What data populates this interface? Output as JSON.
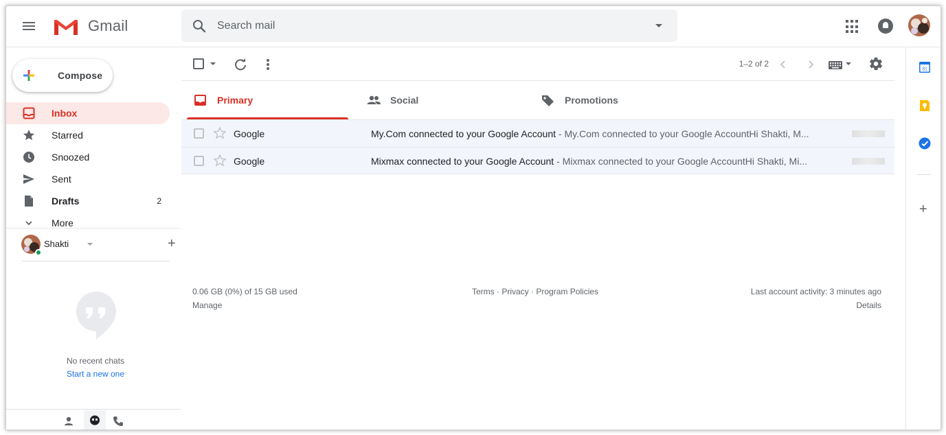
{
  "header": {
    "app_name": "Gmail",
    "search_placeholder": "Search mail"
  },
  "sidebar": {
    "compose_label": "Compose",
    "items": [
      {
        "label": "Inbox",
        "count": "",
        "icon": "inbox-icon",
        "active": true
      },
      {
        "label": "Starred",
        "count": "",
        "icon": "star-icon"
      },
      {
        "label": "Snoozed",
        "count": "",
        "icon": "clock-icon"
      },
      {
        "label": "Sent",
        "count": "",
        "icon": "send-icon"
      },
      {
        "label": "Drafts",
        "count": "2",
        "icon": "draft-icon"
      },
      {
        "label": "More",
        "count": "",
        "icon": "chevron-down-icon"
      }
    ]
  },
  "hangouts": {
    "user_name": "Shakti",
    "no_chats_text": "No recent chats",
    "start_new_text": "Start a new one"
  },
  "toolbar": {
    "pagination": "1–2 of 2"
  },
  "tabs": [
    {
      "label": "Primary",
      "active": true
    },
    {
      "label": "Social"
    },
    {
      "label": "Promotions"
    }
  ],
  "emails": [
    {
      "sender": "Google",
      "subject": "My.Com connected to your Google Account",
      "snippet": " - My.Com connected to your Google AccountHi Shakti, M..."
    },
    {
      "sender": "Google",
      "subject": "Mixmax connected to your Google Account",
      "snippet": " - Mixmax connected to your Google AccountHi Shakti, Mi..."
    }
  ],
  "footer": {
    "storage": "0.06 GB (0%) of 15 GB used",
    "manage": "Manage",
    "terms": "Terms",
    "privacy": "Privacy",
    "program_policies": "Program Policies",
    "separator": " · ",
    "last_activity": "Last account activity: 3 minutes ago",
    "details": "Details"
  },
  "side_panel": {
    "calendar_day": "31"
  },
  "colors": {
    "accent_red": "#d93025",
    "active_bg": "#fce8e6",
    "link_blue": "#1a73e8"
  }
}
